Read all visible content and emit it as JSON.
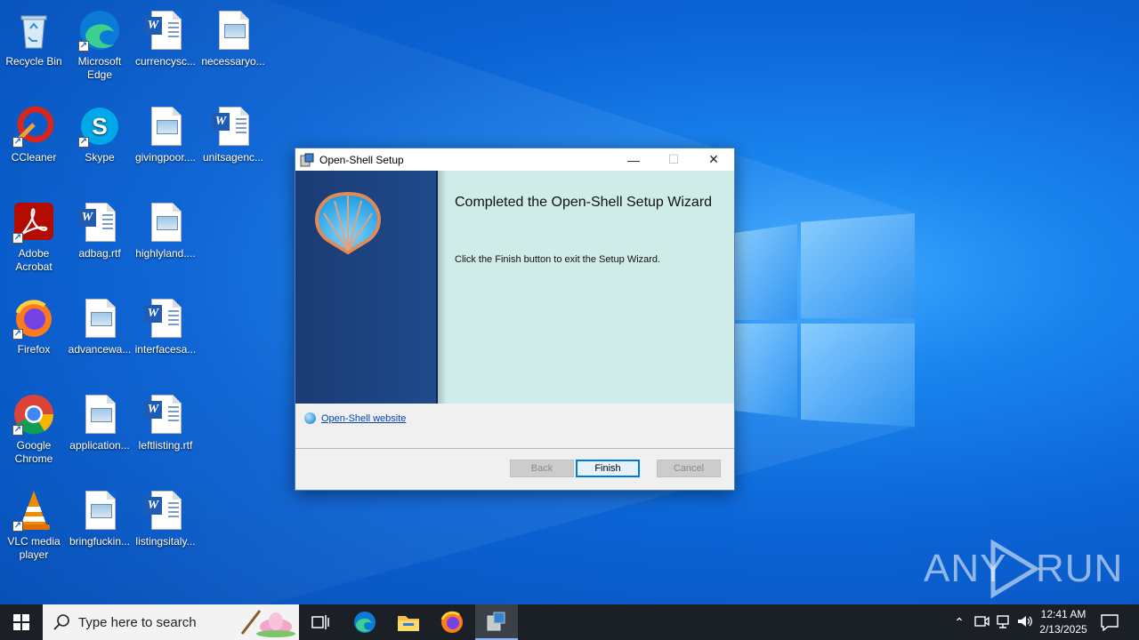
{
  "desktop": {
    "icons": [
      {
        "label": "Recycle Bin"
      },
      {
        "label": "Microsoft Edge"
      },
      {
        "label": "currencysc..."
      },
      {
        "label": "necessaryo..."
      },
      {
        "label": "CCleaner"
      },
      {
        "label": "Skype"
      },
      {
        "label": "givingpoor...."
      },
      {
        "label": "unitsagenc..."
      },
      {
        "label": "Adobe Acrobat"
      },
      {
        "label": "adbag.rtf"
      },
      {
        "label": "highlyland...."
      },
      {
        "label": "Firefox"
      },
      {
        "label": "advancewa..."
      },
      {
        "label": "interfacesa..."
      },
      {
        "label": "Google Chrome"
      },
      {
        "label": "application..."
      },
      {
        "label": "leftlisting.rtf"
      },
      {
        "label": "VLC media player"
      },
      {
        "label": "bringfuckin..."
      },
      {
        "label": "listingsitaly..."
      }
    ]
  },
  "setup": {
    "title": "Open-Shell Setup",
    "heading": "Completed the Open-Shell Setup Wizard",
    "subtext": "Click the Finish button to exit the Setup Wizard.",
    "website_link": "Open-Shell website",
    "buttons": {
      "back": "Back",
      "finish": "Finish",
      "cancel": "Cancel"
    },
    "controls": {
      "minimize": "—",
      "maximize": "☐",
      "close": "✕"
    }
  },
  "watermark": {
    "left": "ANY",
    "right": "RUN"
  },
  "taskbar": {
    "search_placeholder": "Type here to search",
    "clock_time": "12:41 AM",
    "clock_date": "2/13/2025"
  },
  "colors": {
    "accent": "#0078d7",
    "banner": "#1f4a8c",
    "panel": "#cfece9"
  }
}
